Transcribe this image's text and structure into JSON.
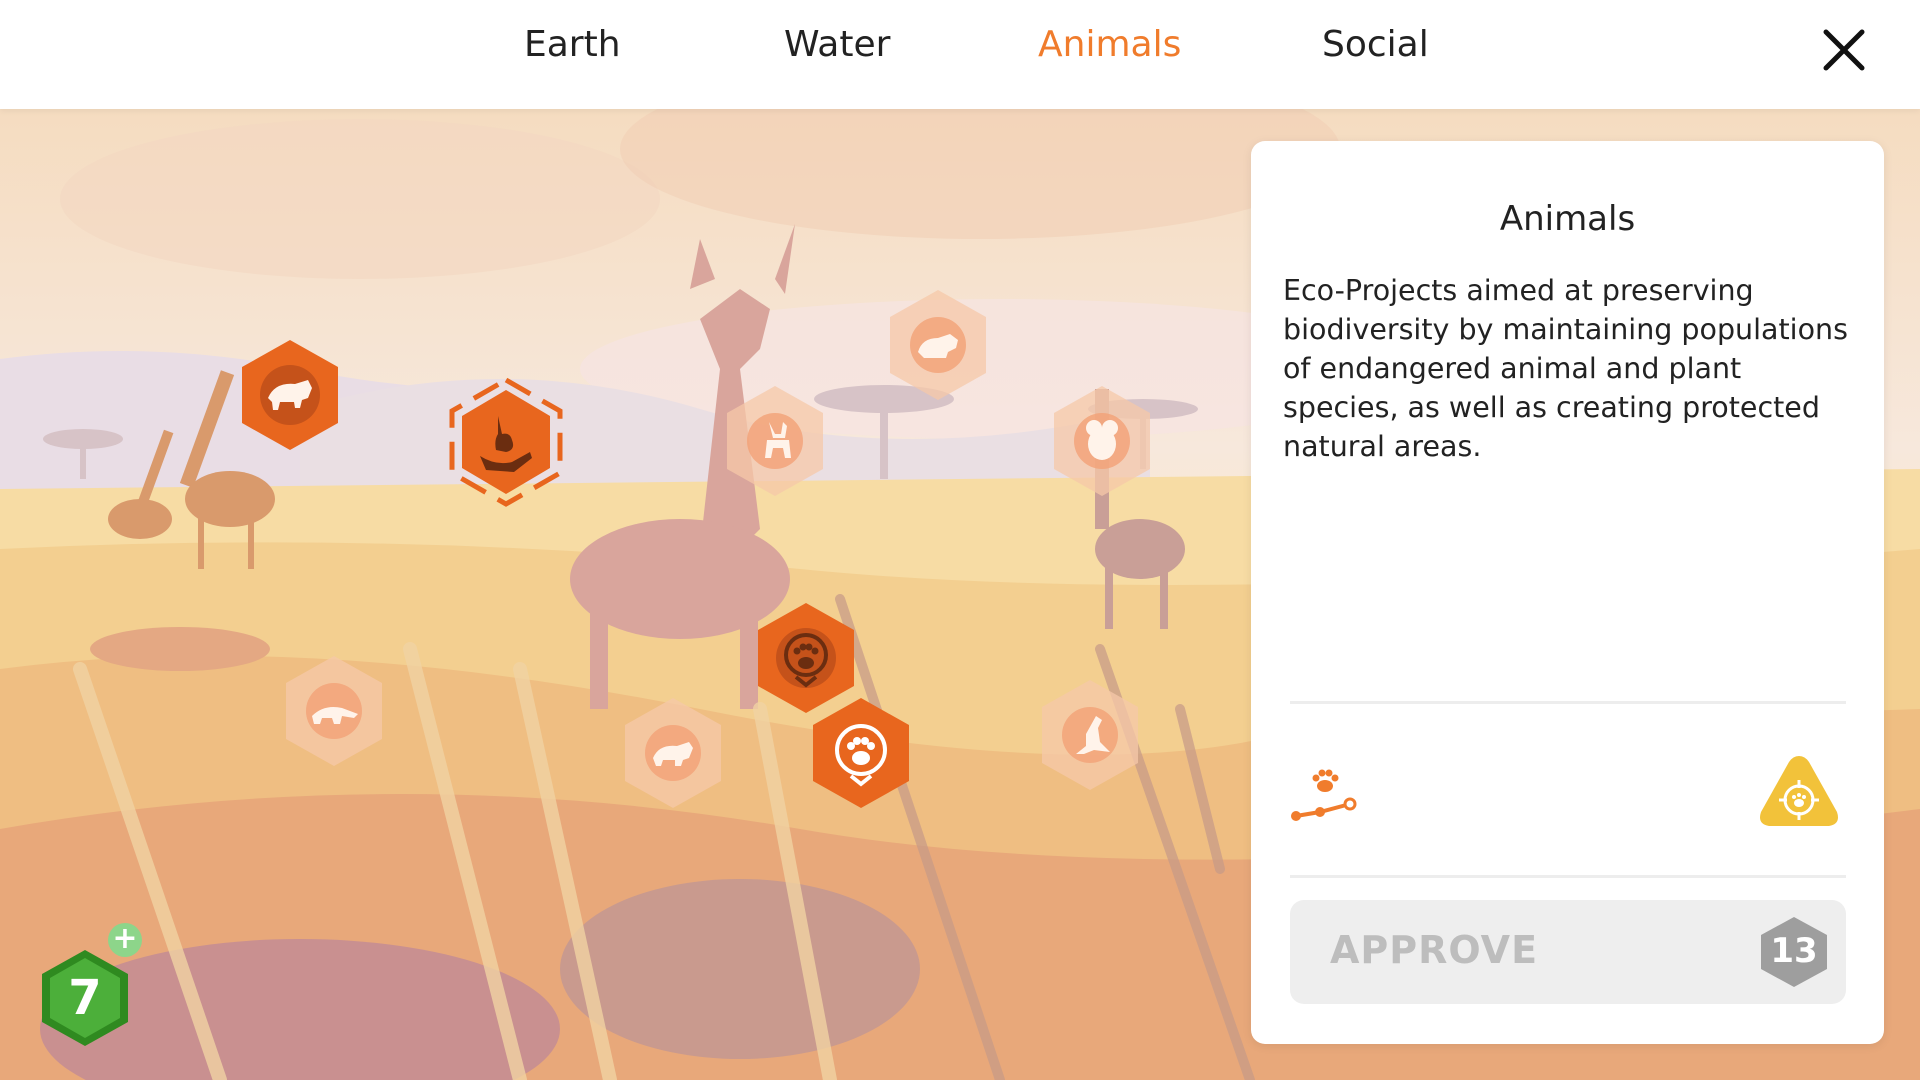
{
  "tabs": [
    {
      "label": "Earth",
      "active": false
    },
    {
      "label": "Water",
      "active": false
    },
    {
      "label": "Animals",
      "active": true
    },
    {
      "label": "Social",
      "active": false
    }
  ],
  "colors": {
    "accent": "#f07c2c",
    "hex_active": "#e8661e",
    "hex_faded": "#f6c8a8",
    "level_green": "#3d9a2b",
    "cost_gray": "#9e9e9e",
    "target_yellow": "#f2c23a"
  },
  "panel": {
    "title": "Animals",
    "description": "Eco-Projects aimed at preserving biodiversity by maintaining populations of endangered animal and plant species, as well as creating protected natural areas.",
    "approve_label": "APPROVE",
    "approve_cost": "13"
  },
  "player": {
    "level": "7"
  },
  "skill_nodes": [
    {
      "name": "rhino-hex",
      "icon": "rhino-icon",
      "state": "unlocked"
    },
    {
      "name": "rabbit-hand-hex",
      "icon": "rabbit-hand-icon",
      "state": "selected"
    },
    {
      "name": "antelope-hex",
      "icon": "antelope-icon",
      "state": "locked"
    },
    {
      "name": "tiger-hex",
      "icon": "tiger-icon",
      "state": "locked"
    },
    {
      "name": "koala-hex",
      "icon": "koala-icon",
      "state": "locked"
    },
    {
      "name": "paw-shield-hex",
      "icon": "paw-shield-icon",
      "state": "unlocked"
    },
    {
      "name": "paw-location-hex",
      "icon": "paw-location-icon",
      "state": "unlocked"
    },
    {
      "name": "anteater-hex",
      "icon": "anteater-icon",
      "state": "locked"
    },
    {
      "name": "rhino-small-hex",
      "icon": "rhino-icon",
      "state": "locked"
    },
    {
      "name": "kangaroo-hex",
      "icon": "kangaroo-icon",
      "state": "locked"
    }
  ]
}
